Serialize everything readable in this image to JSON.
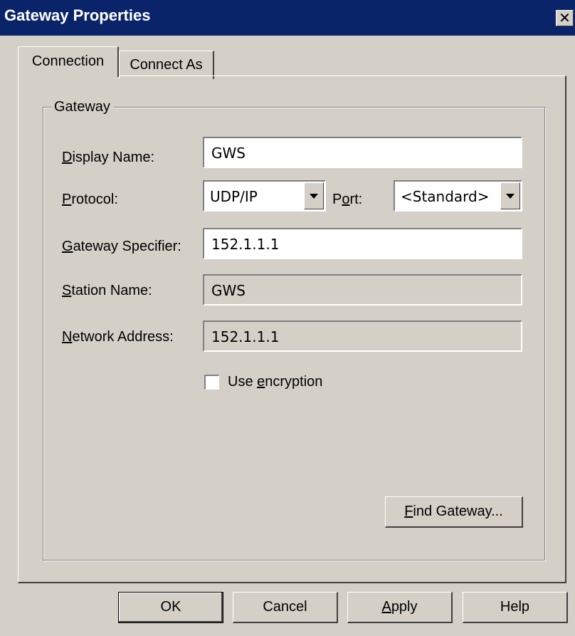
{
  "window": {
    "title": "Gateway Properties",
    "close_glyph": "✕"
  },
  "tabs": [
    {
      "label": "Connection",
      "active": true
    },
    {
      "label": "Connect As",
      "active": false
    }
  ],
  "group": {
    "label": "Gateway"
  },
  "fields": {
    "display_name": {
      "label_pre": "",
      "label_key": "D",
      "label_post": "isplay Name:",
      "value": "GWS"
    },
    "protocol": {
      "label_pre": "",
      "label_key": "P",
      "label_post": "rotocol:",
      "value": "UDP/IP"
    },
    "port": {
      "label_pre": "P",
      "label_key": "o",
      "label_post": "rt:",
      "value": "<Standard>"
    },
    "gateway_specifier": {
      "label_pre": "",
      "label_key": "G",
      "label_post": "ateway Specifier:",
      "value": "152.1.1.1"
    },
    "station_name": {
      "label_pre": "",
      "label_key": "S",
      "label_post": "tation Name:",
      "value": "GWS"
    },
    "network_address": {
      "label_pre": "",
      "label_key": "N",
      "label_post": "etwork Address:",
      "value": "152.1.1.1"
    }
  },
  "encryption": {
    "label_pre": "Use ",
    "label_key": "e",
    "label_post": "ncryption",
    "checked": false
  },
  "find_gateway": {
    "label_pre": "",
    "label_key": "F",
    "label_post": "ind Gateway..."
  },
  "buttons": {
    "ok": "OK",
    "cancel": "Cancel",
    "apply": {
      "label_pre": "",
      "label_key": "A",
      "label_post": "pply"
    },
    "help": "Help"
  }
}
